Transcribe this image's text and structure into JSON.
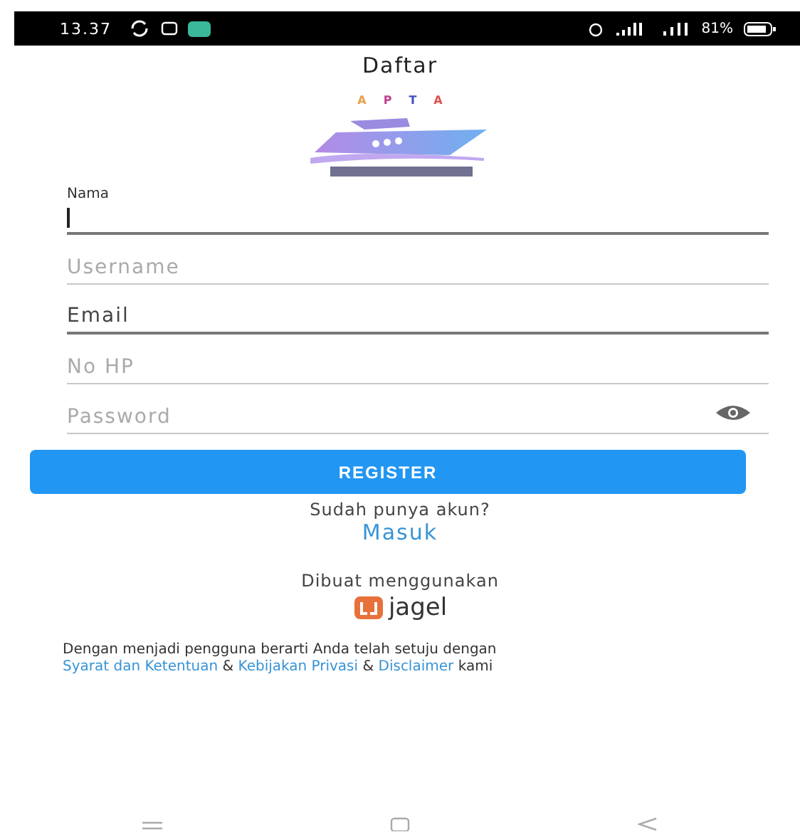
{
  "status_bar": {
    "time": "13.37",
    "battery": "81%"
  },
  "title": "Daftar",
  "logo": {
    "letters": [
      {
        "text": "A",
        "color": "#e8a04a"
      },
      {
        "text": "P",
        "color": "#c04090"
      },
      {
        "text": "T",
        "color": "#4050c0"
      },
      {
        "text": "A",
        "color": "#e05050"
      }
    ]
  },
  "fields": [
    {
      "kind": "floating",
      "label": "Nama",
      "focused": true
    },
    {
      "kind": "text",
      "placeholder": "Username",
      "focused": false
    },
    {
      "kind": "text",
      "placeholder": "Email",
      "focused": true
    },
    {
      "kind": "text",
      "placeholder": "No HP",
      "focused": false
    },
    {
      "kind": "password",
      "placeholder": "Password",
      "focused": false
    }
  ],
  "register_button": "REGISTER",
  "login_prompt": "Sudah punya akun?",
  "login_link": "Masuk",
  "made_with": "Dibuat menggunakan",
  "brand": "jagel",
  "terms": {
    "text": "Dengan menjadi pengguna berarti Anda telah setuju dengan",
    "parts": [
      {
        "kind": "link",
        "text": "Syarat dan Ketentuan"
      },
      {
        "kind": "plain",
        "text": "&"
      },
      {
        "kind": "link",
        "text": "Kebijakan Privasi"
      },
      {
        "kind": "plain",
        "text": "&"
      },
      {
        "kind": "link",
        "text": "Disclaimer"
      },
      {
        "kind": "plain",
        "text": "kami"
      }
    ]
  }
}
